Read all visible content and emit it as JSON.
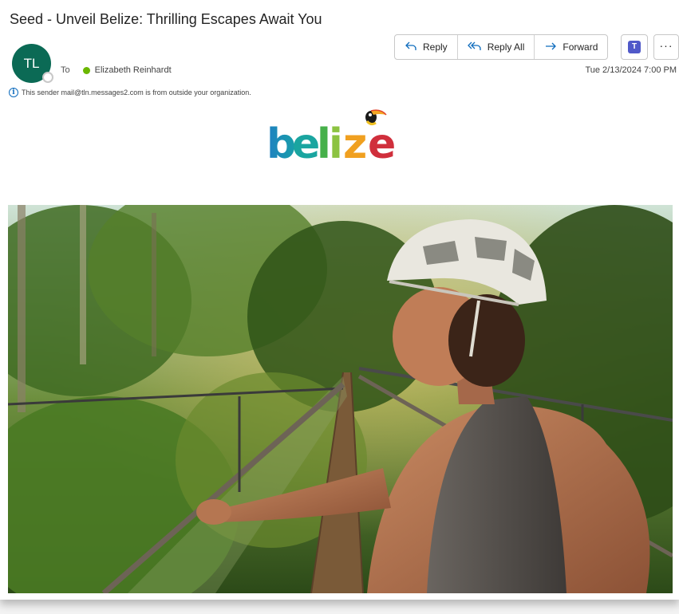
{
  "email": {
    "subject": "Seed - Unveil Belize: Thrilling Escapes Await You",
    "sender_initials": "TL",
    "to_label": "To",
    "recipient": "Elizabeth Reinhardt",
    "external_notice": "This sender mail@tln.messages2.com is from outside your organization.",
    "date": "Tue 2/13/2024 7:00 PM"
  },
  "toolbar": {
    "reply_label": "Reply",
    "reply_all_label": "Reply All",
    "forward_label": "Forward",
    "more_label": "···"
  },
  "body": {
    "logo_text": "belize"
  },
  "icons": [
    "info-icon",
    "reply-icon",
    "reply-all-icon",
    "forward-icon",
    "teams-icon",
    "more-icon",
    "toucan-icon"
  ],
  "colors": {
    "avatar": "#0b6a55",
    "accent": "#0f6cbd",
    "presence_online": "#6bb700",
    "teams": "#5059c9"
  }
}
